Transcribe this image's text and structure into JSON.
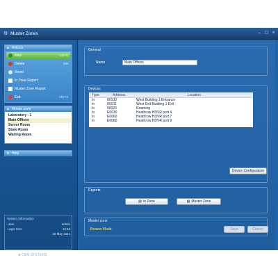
{
  "window": {
    "title": "Muster Zones"
  },
  "actions": {
    "header": "Actions",
    "items": [
      {
        "label": "New",
        "shortcut": "Ctrl+N"
      },
      {
        "label": "Delete",
        "shortcut": "Del"
      },
      {
        "label": "Reset",
        "shortcut": ""
      },
      {
        "label": "In Zone Report",
        "shortcut": ""
      },
      {
        "label": "Muster Zone Report",
        "shortcut": ""
      },
      {
        "label": "Exit",
        "shortcut": "Alt+F4"
      }
    ]
  },
  "muster_zone": {
    "header": "Muster zone",
    "items": [
      "Laboratory - 1",
      "Main Offices",
      "Server Room",
      "Store Room",
      "Waiting Room"
    ],
    "selected": "Main Offices"
  },
  "help": {
    "header": "Help"
  },
  "system_info": {
    "title": "System Information",
    "rows": [
      {
        "label": "User",
        "value": "admin"
      },
      {
        "label": "Login time",
        "value": "10:46"
      },
      {
        "label": "",
        "value": "30 May 2011"
      }
    ]
  },
  "logo": {
    "text": "CEM SYSTEMS"
  },
  "general": {
    "title": "General",
    "name_label": "Name",
    "name_value": "Main Offices"
  },
  "devices": {
    "title": "Devices",
    "columns": [
      "Type",
      "Address",
      "Location"
    ],
    "rows": [
      {
        "type": "In",
        "address": "00100",
        "location": "West Building 1 Entrance"
      },
      {
        "type": "In",
        "address": "00101",
        "location": "West Exit Building 1 Exit"
      },
      {
        "type": "In",
        "address": "00020",
        "location": "Roaming"
      },
      {
        "type": "In",
        "address": "E0030",
        "location": "Heathrow HDVR port 4"
      },
      {
        "type": "In",
        "address": "E0060",
        "location": "Heathrow HDVR port 7"
      },
      {
        "type": "In",
        "address": "E0060",
        "location": "Heathrow HDVR port 9"
      }
    ],
    "config_button": "Device Configuration"
  },
  "reports": {
    "title": "Reports",
    "in_zone": "In Zone",
    "muster_zone": "Muster Zone"
  },
  "muster_zone_section": {
    "title": "Muster zone",
    "mode": "Browse Mode",
    "save": "Save",
    "cancel": "Cancel"
  },
  "colors": {
    "window": "#1f63a8",
    "action_new": "#5cb44a",
    "browse_mode": "#ffe85c"
  }
}
